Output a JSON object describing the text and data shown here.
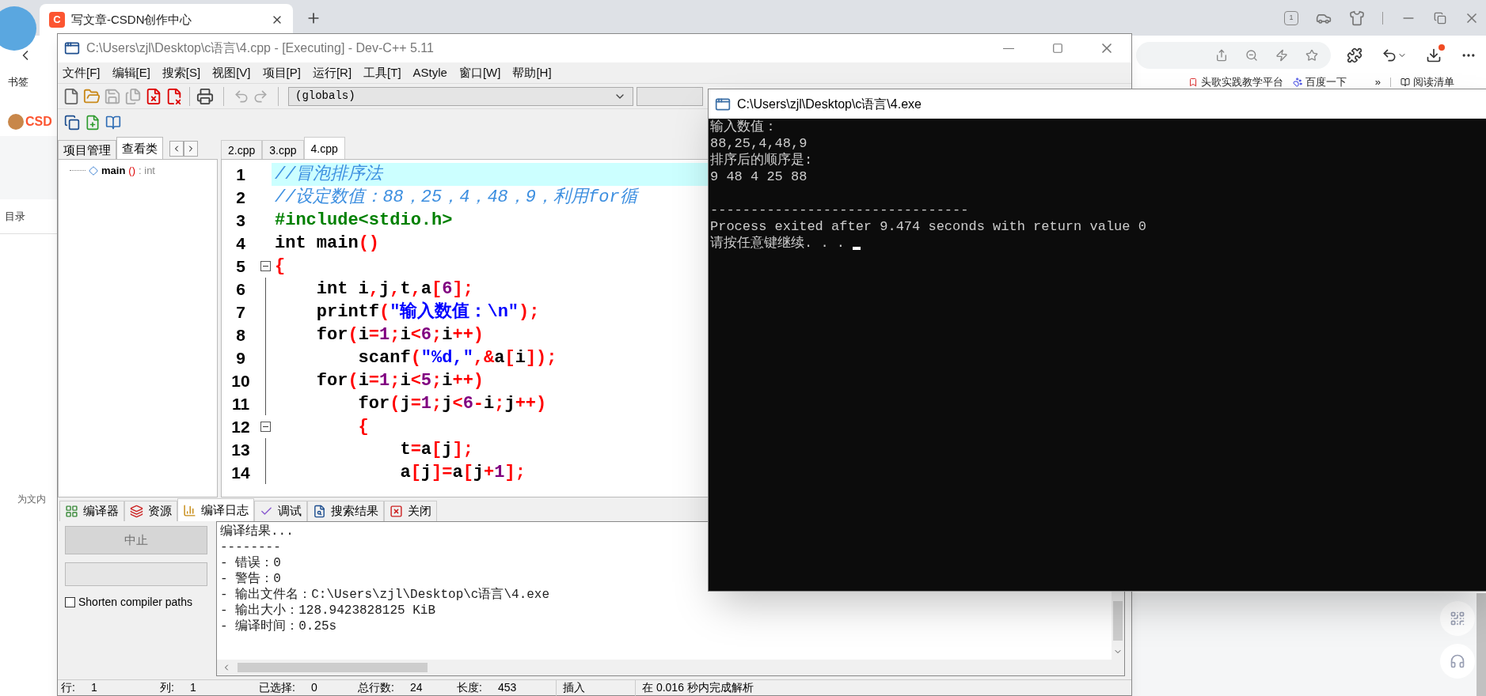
{
  "browser": {
    "tab": {
      "favicon": "C",
      "title": "写文章-CSDN创作中心"
    },
    "tab_count": "1",
    "bookmarks_label": "书签",
    "bookmarks": [
      {
        "label": "头歌实践教学平台"
      },
      {
        "label": "百度一下"
      }
    ],
    "more_bookmarks": "»",
    "reading_list": "阅读清单",
    "site_logo": "CSD",
    "toc_label": "目录",
    "side_note": "为文内"
  },
  "devcpp": {
    "title": "C:\\Users\\zjl\\Desktop\\c语言\\4.cpp - [Executing] - Dev-C++ 5.11",
    "menu": [
      "文件[F]",
      "编辑[E]",
      "搜索[S]",
      "视图[V]",
      "项目[P]",
      "运行[R]",
      "工具[T]",
      "AStyle",
      "窗口[W]",
      "帮助[H]"
    ],
    "scope_combo": "(globals)",
    "side_tabs": [
      {
        "label": "项目管理",
        "selected": false
      },
      {
        "label": "查看类",
        "selected": true
      }
    ],
    "class_tree": [
      {
        "name": "main",
        "parens": "()",
        "type": ": int"
      }
    ],
    "file_tabs": [
      {
        "label": "2.cpp",
        "selected": false
      },
      {
        "label": "3.cpp",
        "selected": false
      },
      {
        "label": "4.cpp",
        "selected": true
      }
    ],
    "code_lines": [
      {
        "number": "1",
        "current": true,
        "fold": false,
        "tokens": [
          {
            "kind": "comment",
            "text": "//冒泡排序法"
          }
        ]
      },
      {
        "number": "2",
        "current": false,
        "fold": false,
        "tokens": [
          {
            "kind": "comment",
            "text": "//设定数值：88，25，4，48，9，利用for循"
          }
        ]
      },
      {
        "number": "3",
        "current": false,
        "fold": false,
        "tokens": [
          {
            "kind": "preproc",
            "text": "#include<stdio.h>"
          }
        ]
      },
      {
        "number": "4",
        "current": false,
        "fold": false,
        "tokens": [
          {
            "kind": "keyword",
            "text": "int"
          },
          {
            "kind": "plain",
            "text": " main"
          },
          {
            "kind": "symbol",
            "text": "()"
          }
        ]
      },
      {
        "number": "5",
        "current": false,
        "fold": true,
        "tokens": [
          {
            "kind": "symbol",
            "text": "{"
          }
        ]
      },
      {
        "number": "6",
        "current": false,
        "fold": false,
        "tokens": [
          {
            "kind": "keyword",
            "text": "    int"
          },
          {
            "kind": "plain",
            "text": " i"
          },
          {
            "kind": "symbol",
            "text": ","
          },
          {
            "kind": "plain",
            "text": "j"
          },
          {
            "kind": "symbol",
            "text": ","
          },
          {
            "kind": "plain",
            "text": "t"
          },
          {
            "kind": "symbol",
            "text": ","
          },
          {
            "kind": "plain",
            "text": "a"
          },
          {
            "kind": "symbol",
            "text": "["
          },
          {
            "kind": "number",
            "text": "6"
          },
          {
            "kind": "symbol",
            "text": "];"
          }
        ]
      },
      {
        "number": "7",
        "current": false,
        "fold": false,
        "tokens": [
          {
            "kind": "plain",
            "text": "    printf"
          },
          {
            "kind": "symbol",
            "text": "("
          },
          {
            "kind": "string",
            "text": "\"输入数值：\\n\""
          },
          {
            "kind": "symbol",
            "text": ");"
          }
        ]
      },
      {
        "number": "8",
        "current": false,
        "fold": false,
        "tokens": [
          {
            "kind": "keyword",
            "text": "    for"
          },
          {
            "kind": "symbol",
            "text": "("
          },
          {
            "kind": "plain",
            "text": "i"
          },
          {
            "kind": "symbol",
            "text": "="
          },
          {
            "kind": "number",
            "text": "1"
          },
          {
            "kind": "symbol",
            "text": ";"
          },
          {
            "kind": "plain",
            "text": "i"
          },
          {
            "kind": "symbol",
            "text": "<"
          },
          {
            "kind": "number",
            "text": "6"
          },
          {
            "kind": "symbol",
            "text": ";"
          },
          {
            "kind": "plain",
            "text": "i"
          },
          {
            "kind": "symbol",
            "text": "++)"
          }
        ]
      },
      {
        "number": "9",
        "current": false,
        "fold": false,
        "tokens": [
          {
            "kind": "plain",
            "text": "        scanf"
          },
          {
            "kind": "symbol",
            "text": "("
          },
          {
            "kind": "string",
            "text": "\"%d,\""
          },
          {
            "kind": "symbol",
            "text": ",&"
          },
          {
            "kind": "plain",
            "text": "a"
          },
          {
            "kind": "symbol",
            "text": "["
          },
          {
            "kind": "plain",
            "text": "i"
          },
          {
            "kind": "symbol",
            "text": "]);"
          }
        ]
      },
      {
        "number": "10",
        "current": false,
        "fold": false,
        "tokens": [
          {
            "kind": "keyword",
            "text": "    for"
          },
          {
            "kind": "symbol",
            "text": "("
          },
          {
            "kind": "plain",
            "text": "i"
          },
          {
            "kind": "symbol",
            "text": "="
          },
          {
            "kind": "number",
            "text": "1"
          },
          {
            "kind": "symbol",
            "text": ";"
          },
          {
            "kind": "plain",
            "text": "i"
          },
          {
            "kind": "symbol",
            "text": "<"
          },
          {
            "kind": "number",
            "text": "5"
          },
          {
            "kind": "symbol",
            "text": ";"
          },
          {
            "kind": "plain",
            "text": "i"
          },
          {
            "kind": "symbol",
            "text": "++)"
          }
        ]
      },
      {
        "number": "11",
        "current": false,
        "fold": false,
        "tokens": [
          {
            "kind": "keyword",
            "text": "        for"
          },
          {
            "kind": "symbol",
            "text": "("
          },
          {
            "kind": "plain",
            "text": "j"
          },
          {
            "kind": "symbol",
            "text": "="
          },
          {
            "kind": "number",
            "text": "1"
          },
          {
            "kind": "symbol",
            "text": ";"
          },
          {
            "kind": "plain",
            "text": "j"
          },
          {
            "kind": "symbol",
            "text": "<"
          },
          {
            "kind": "number",
            "text": "6"
          },
          {
            "kind": "symbol",
            "text": "-"
          },
          {
            "kind": "plain",
            "text": "i"
          },
          {
            "kind": "symbol",
            "text": ";"
          },
          {
            "kind": "plain",
            "text": "j"
          },
          {
            "kind": "symbol",
            "text": "++)"
          }
        ]
      },
      {
        "number": "12",
        "current": false,
        "fold": true,
        "tokens": [
          {
            "kind": "symbol",
            "text": "        {"
          }
        ]
      },
      {
        "number": "13",
        "current": false,
        "fold": false,
        "tokens": [
          {
            "kind": "plain",
            "text": "            t"
          },
          {
            "kind": "symbol",
            "text": "="
          },
          {
            "kind": "plain",
            "text": "a"
          },
          {
            "kind": "symbol",
            "text": "["
          },
          {
            "kind": "plain",
            "text": "j"
          },
          {
            "kind": "symbol",
            "text": "];"
          }
        ]
      },
      {
        "number": "14",
        "current": false,
        "fold": false,
        "tokens": [
          {
            "kind": "plain",
            "text": "            a"
          },
          {
            "kind": "symbol",
            "text": "["
          },
          {
            "kind": "plain",
            "text": "j"
          },
          {
            "kind": "symbol",
            "text": "]="
          },
          {
            "kind": "plain",
            "text": "a"
          },
          {
            "kind": "symbol",
            "text": "["
          },
          {
            "kind": "plain",
            "text": "j"
          },
          {
            "kind": "symbol",
            "text": "+"
          },
          {
            "kind": "number",
            "text": "1"
          },
          {
            "kind": "symbol",
            "text": "];"
          }
        ]
      }
    ],
    "bottom_tabs": [
      {
        "label": "编译器",
        "selected": false
      },
      {
        "label": "资源",
        "selected": false
      },
      {
        "label": "编译日志",
        "selected": true
      },
      {
        "label": "调试",
        "selected": false
      },
      {
        "label": "搜索结果",
        "selected": false
      },
      {
        "label": "关闭",
        "selected": false
      }
    ],
    "stop_button": {
      "label": "中止",
      "disabled": true
    },
    "progress": {
      "level": 0
    },
    "shorten_paths": {
      "label": "Shorten compiler paths",
      "checked": false
    },
    "log_lines": [
      "编译结果...",
      "--------",
      "- 错误：0",
      "- 警告：0",
      "- 输出文件名：C:\\Users\\zjl\\Desktop\\c语言\\4.exe",
      "- 输出大小：128.9423828125 KiB",
      "- 编译时间：0.25s"
    ],
    "status_bar": {
      "fields": [
        {
          "label": "行:",
          "value": "1"
        },
        {
          "label": "列:",
          "value": "1"
        },
        {
          "label": "已选择:",
          "value": "0"
        },
        {
          "label": "总行数:",
          "value": "24"
        },
        {
          "label": "长度:",
          "value": "453"
        }
      ],
      "mode": "插入",
      "message": "在 0.016 秒内完成解析"
    }
  },
  "console": {
    "title": "C:\\Users\\zjl\\Desktop\\c语言\\4.exe",
    "cursor": true,
    "lines": [
      {
        "text": "输入数值：",
        "gap_before": false
      },
      {
        "text": "88,25,4,48,9",
        "gap_before": false
      },
      {
        "text": "排序后的顺序是:",
        "gap_before": false
      },
      {
        "text": "9 48 4 25 88",
        "gap_before": false
      },
      {
        "text": "--------------------------------",
        "gap_before": true
      },
      {
        "text": "Process exited after 9.474 seconds with return value 0",
        "gap_before": false
      },
      {
        "text": "请按任意键继续. . . ",
        "gap_before": false
      }
    ]
  }
}
